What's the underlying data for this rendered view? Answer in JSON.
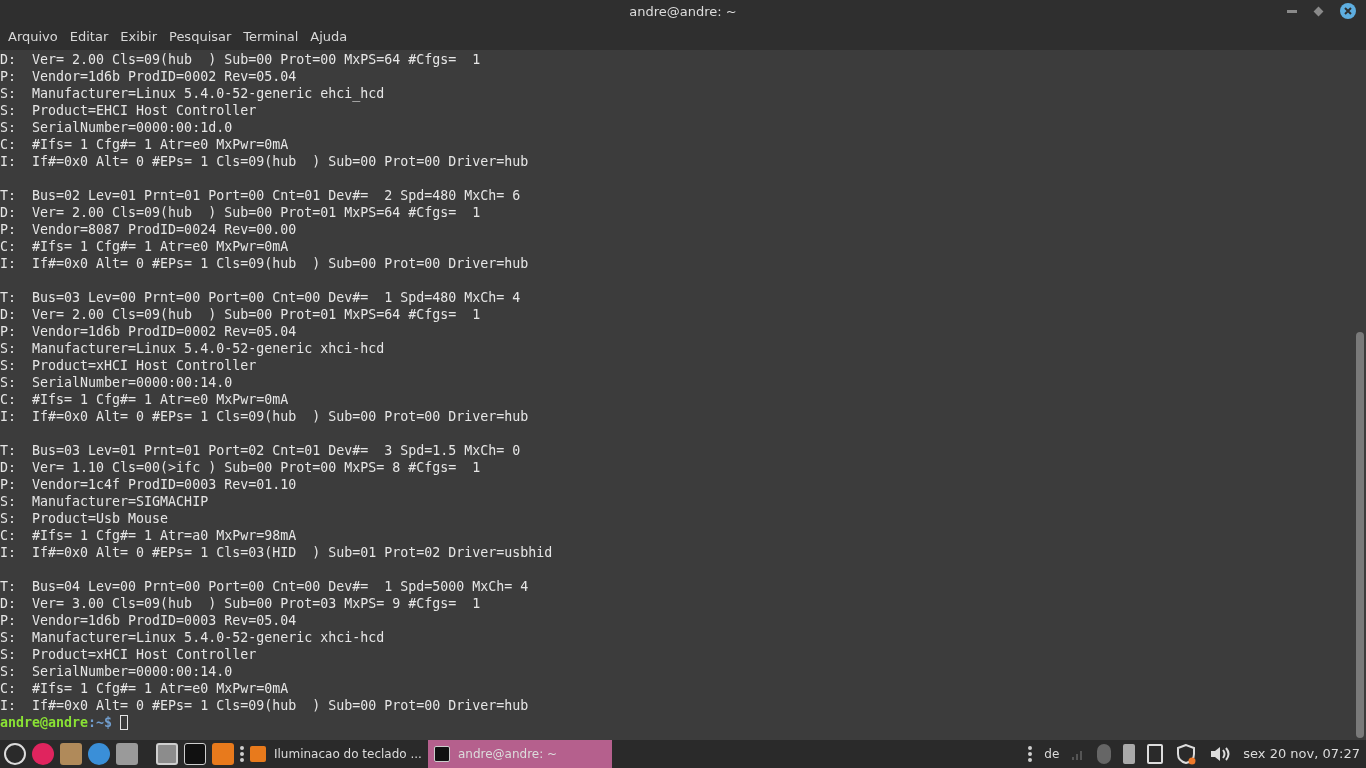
{
  "window": {
    "title": "andre@andre: ~"
  },
  "menu": [
    "Arquivo",
    "Editar",
    "Exibir",
    "Pesquisar",
    "Terminal",
    "Ajuda"
  ],
  "terminal": {
    "blocks": [
      [
        "D:  Ver= 2.00 Cls=09(hub  ) Sub=00 Prot=00 MxPS=64 #Cfgs=  1",
        "P:  Vendor=1d6b ProdID=0002 Rev=05.04",
        "S:  Manufacturer=Linux 5.4.0-52-generic ehci_hcd",
        "S:  Product=EHCI Host Controller",
        "S:  SerialNumber=0000:00:1d.0",
        "C:  #Ifs= 1 Cfg#= 1 Atr=e0 MxPwr=0mA",
        "I:  If#=0x0 Alt= 0 #EPs= 1 Cls=09(hub  ) Sub=00 Prot=00 Driver=hub"
      ],
      [
        "T:  Bus=02 Lev=01 Prnt=01 Port=00 Cnt=01 Dev#=  2 Spd=480 MxCh= 6",
        "D:  Ver= 2.00 Cls=09(hub  ) Sub=00 Prot=01 MxPS=64 #Cfgs=  1",
        "P:  Vendor=8087 ProdID=0024 Rev=00.00",
        "C:  #Ifs= 1 Cfg#= 1 Atr=e0 MxPwr=0mA",
        "I:  If#=0x0 Alt= 0 #EPs= 1 Cls=09(hub  ) Sub=00 Prot=00 Driver=hub"
      ],
      [
        "T:  Bus=03 Lev=00 Prnt=00 Port=00 Cnt=00 Dev#=  1 Spd=480 MxCh= 4",
        "D:  Ver= 2.00 Cls=09(hub  ) Sub=00 Prot=01 MxPS=64 #Cfgs=  1",
        "P:  Vendor=1d6b ProdID=0002 Rev=05.04",
        "S:  Manufacturer=Linux 5.4.0-52-generic xhci-hcd",
        "S:  Product=xHCI Host Controller",
        "S:  SerialNumber=0000:00:14.0",
        "C:  #Ifs= 1 Cfg#= 1 Atr=e0 MxPwr=0mA",
        "I:  If#=0x0 Alt= 0 #EPs= 1 Cls=09(hub  ) Sub=00 Prot=00 Driver=hub"
      ],
      [
        "T:  Bus=03 Lev=01 Prnt=01 Port=02 Cnt=01 Dev#=  3 Spd=1.5 MxCh= 0",
        "D:  Ver= 1.10 Cls=00(>ifc ) Sub=00 Prot=00 MxPS= 8 #Cfgs=  1",
        "P:  Vendor=1c4f ProdID=0003 Rev=01.10",
        "S:  Manufacturer=SIGMACHIP",
        "S:  Product=Usb Mouse",
        "C:  #Ifs= 1 Cfg#= 1 Atr=a0 MxPwr=98mA",
        "I:  If#=0x0 Alt= 0 #EPs= 1 Cls=03(HID  ) Sub=01 Prot=02 Driver=usbhid"
      ],
      [
        "T:  Bus=04 Lev=00 Prnt=00 Port=00 Cnt=00 Dev#=  1 Spd=5000 MxCh= 4",
        "D:  Ver= 3.00 Cls=09(hub  ) Sub=00 Prot=03 MxPS= 9 #Cfgs=  1",
        "P:  Vendor=1d6b ProdID=0003 Rev=05.04",
        "S:  Manufacturer=Linux 5.4.0-52-generic xhci-hcd",
        "S:  Product=xHCI Host Controller",
        "S:  SerialNumber=0000:00:14.0",
        "C:  #Ifs= 1 Cfg#= 1 Atr=e0 MxPwr=0mA",
        "I:  If#=0x0 Alt= 0 #EPs= 1 Cls=09(hub  ) Sub=00 Prot=00 Driver=hub"
      ]
    ],
    "prompt": {
      "user": "andre@andre",
      "path": ":~$"
    }
  },
  "taskbar": {
    "windows": [
      {
        "title": "Iluminacao do teclado ...",
        "selected": false
      },
      {
        "title": "andre@andre: ~",
        "selected": true
      }
    ],
    "keyboard_layout": "de",
    "clock": "sex 20 nov, 07:27"
  }
}
